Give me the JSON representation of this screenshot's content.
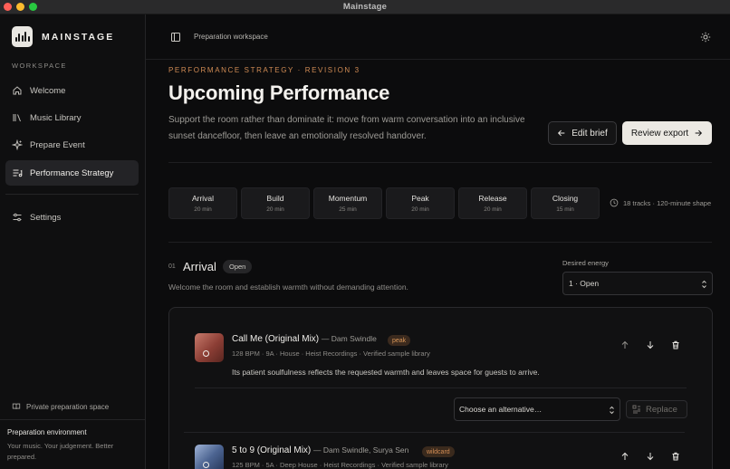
{
  "window": {
    "title": "Mainstage"
  },
  "brand": {
    "name": "MAINSTAGE"
  },
  "sidebar": {
    "section_label": "WORKSPACE",
    "items": [
      {
        "label": "Welcome",
        "icon": "home-icon"
      },
      {
        "label": "Music Library",
        "icon": "library-icon"
      },
      {
        "label": "Prepare Event",
        "icon": "sparkle-icon"
      },
      {
        "label": "Performance Strategy",
        "icon": "strategy-icon",
        "active": true
      }
    ],
    "settings_label": "Settings",
    "private_label": "Private preparation space",
    "env_title": "Preparation environment",
    "env_sub_1": "Your music. Your judgement. Better",
    "env_sub_2": "prepared."
  },
  "topbar": {
    "workspace_label": "Preparation workspace"
  },
  "header": {
    "eyebrow": "PERFORMANCE STRATEGY · REVISION 3",
    "title": "Upcoming Performance",
    "lede": "Support the room rather than dominate it: move from warm conversation into an inclusive sunset dancefloor, then leave an emotionally resolved handover.",
    "edit_label": "Edit brief",
    "review_label": "Review export"
  },
  "phases": [
    {
      "name": "Arrival",
      "duration": "20 min"
    },
    {
      "name": "Build",
      "duration": "20 min"
    },
    {
      "name": "Momentum",
      "duration": "25 min"
    },
    {
      "name": "Peak",
      "duration": "20 min"
    },
    {
      "name": "Release",
      "duration": "20 min"
    },
    {
      "name": "Closing",
      "duration": "15 min"
    }
  ],
  "tracks_info": "18 tracks · 120-minute shape",
  "step": {
    "number": "01",
    "title": "Arrival",
    "status": "Open",
    "description": "Welcome the room and establish warmth without demanding attention.",
    "energy_label": "Desired energy",
    "energy_value": "1 · Open"
  },
  "tracks": [
    {
      "title": "Call Me (Original Mix)",
      "artist": "— Dam Swindle",
      "tag": "peak",
      "meta": "128 BPM · 9A · House · Heist Recordings · Verified sample library",
      "reason": "Its patient soulfulness reflects the requested warmth and leaves space for guests to arrive.",
      "alt_placeholder": "Choose an alternative…",
      "replace_label": "Replace"
    },
    {
      "title": "5 to 9 (Original Mix)",
      "artist": "— Dam Swindle, Surya Sen",
      "tag": "wildcard",
      "meta": "125 BPM · 5A · Deep House · Heist Recordings · Verified sample library"
    }
  ],
  "colors": {
    "accent": "#d08b54",
    "background": "#0c0c0d",
    "sidebar": "#0f0f10"
  }
}
